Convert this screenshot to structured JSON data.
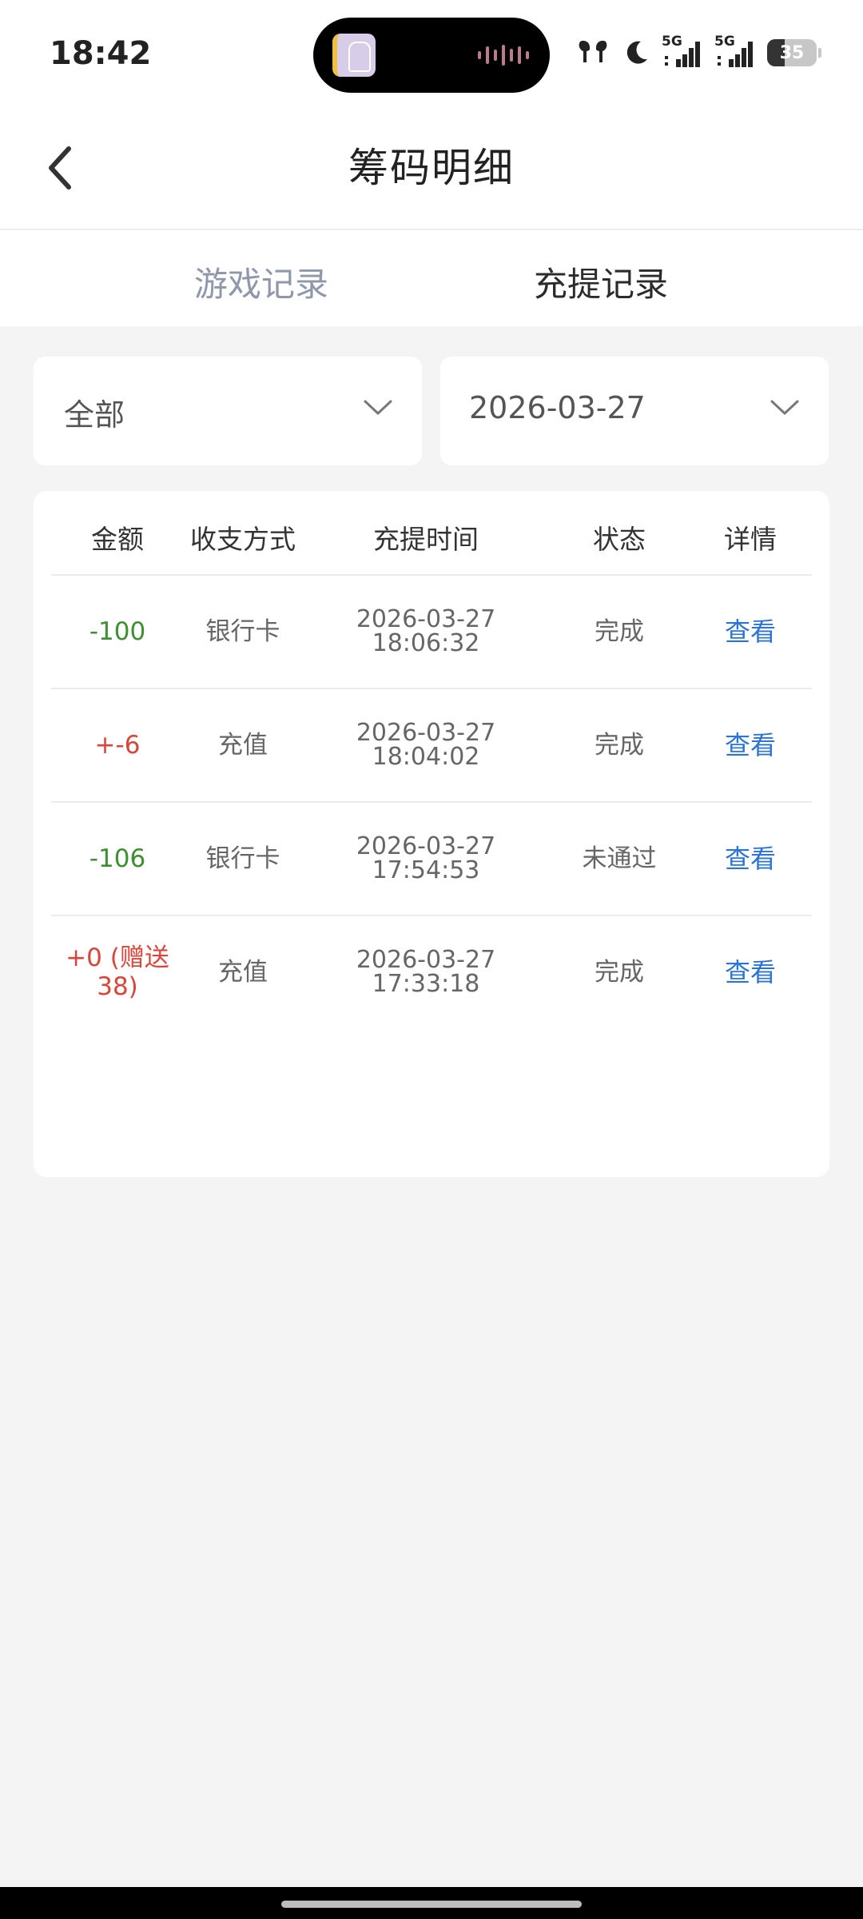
{
  "status_bar": {
    "time": "18:42",
    "network_1": "5G",
    "network_2": "5G",
    "battery": "35"
  },
  "header": {
    "title": "筹码明细",
    "back_icon": "chevron-left-icon"
  },
  "tabs": [
    {
      "label": "游戏记录",
      "active": false
    },
    {
      "label": "充提记录",
      "active": true
    }
  ],
  "filters": {
    "type": "全部",
    "date": "2026-03-27"
  },
  "table": {
    "columns": [
      "金额",
      "收支方式",
      "充提时间",
      "状态",
      "详情"
    ],
    "rows": [
      {
        "amount": "-100",
        "method": "银行卡",
        "date": "2026-03-27",
        "time": "18:06:32",
        "status": "完成",
        "detail": "查看"
      },
      {
        "amount": "+-6",
        "method": "充值",
        "date": "2026-03-27",
        "time": "18:04:02",
        "status": "完成",
        "detail": "查看"
      },
      {
        "amount": "-106",
        "method": "银行卡",
        "date": "2026-03-27",
        "time": "17:54:53",
        "status": "未通过",
        "detail": "查看"
      },
      {
        "amount": "+0 (赠送38)",
        "method": "充值",
        "date": "2026-03-27",
        "time": "17:33:18",
        "status": "完成",
        "detail": "查看"
      }
    ]
  },
  "colors": {
    "negative": "#3d8f2f",
    "positive": "#d8453a",
    "link": "#2b74d6",
    "tab_inactive": "#8f98ab"
  }
}
